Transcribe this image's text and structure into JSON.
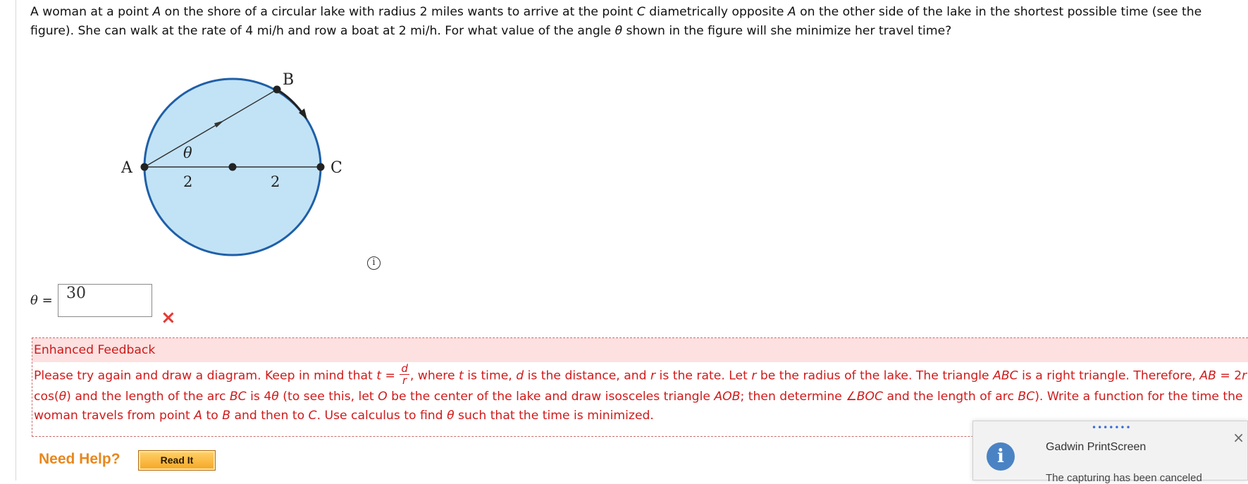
{
  "question": {
    "p1": "A woman at a point ",
    "A1": "A",
    "p2": " on the shore of a circular lake with radius 2 miles wants to arrive at the point ",
    "C1": "C",
    "p3": " diametrically opposite ",
    "A2": "A",
    "p4": " on the other side of the lake in the shortest possible time (see the figure). She can walk at the rate of 4 mi/h and row a boat at 2 mi/h. For what value of the angle ",
    "theta": "θ",
    "p5": " shown in the figure will she minimize her travel time?"
  },
  "figure": {
    "label_a": "A",
    "label_b": "B",
    "label_c": "C",
    "label_theta": "θ",
    "radius_left": "2",
    "radius_right": "2",
    "lake_fill": "#c2e3f6",
    "lake_stroke": "#1f5fa8"
  },
  "info_icon": "i",
  "answer": {
    "label_theta": "θ",
    "label_eq": " = ",
    "value": "30",
    "status_icon": "×"
  },
  "feedback": {
    "header": "Enhanced Feedback",
    "s1": "Please try again and draw a diagram. Keep in mind that ",
    "t": "t",
    "eq": " = ",
    "frac_num": "d",
    "frac_den": "r",
    "s2": ", where ",
    "t2": "t",
    "s3": " is time, ",
    "d": "d",
    "s4": " is the distance, and ",
    "r": "r",
    "s5": " is the rate. Let ",
    "r2": "r",
    "s6": " be the radius of the lake. The triangle ",
    "abc": "ABC",
    "s7": " is a right triangle. Therefore, ",
    "ab": "AB",
    "s8": " = 2",
    "r3": "r",
    "s9": " cos(",
    "th1": "θ",
    "s10": ") and the length of the arc ",
    "bc": "BC",
    "s11": " is 4",
    "th2": "θ",
    "s12": " (to see this, let ",
    "o": "O",
    "s13": " be the center of the lake and draw isosceles triangle ",
    "aob": "AOB",
    "s14": "; then determine ",
    "boc": "∠BOC",
    "s15": " and the length of arc ",
    "bc2": "BC",
    "s16": "). Write a function for the time the woman travels from point ",
    "a": "A",
    "s17": " to ",
    "b": "B",
    "s18": " and then to ",
    "c": "C",
    "s19": ". Use calculus to find ",
    "th3": "θ",
    "s20": " such that the time is minimized."
  },
  "help": {
    "label": "Need Help?",
    "read_button": "Read It"
  },
  "toast": {
    "dots": "•••••••",
    "title": "Gadwin PrintScreen",
    "message": "The capturing has been canceled",
    "close": "×",
    "icon": "i"
  }
}
